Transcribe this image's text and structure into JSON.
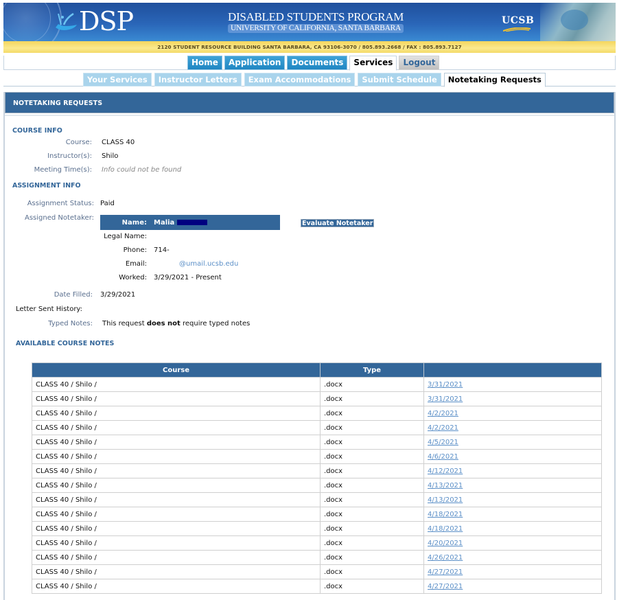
{
  "banner": {
    "logo_text": "DSP",
    "program_title": "DISABLED STUDENTS PROGRAM",
    "university": "UNIVERSITY OF CALIFORNIA, SANTA BARBARA",
    "ucsb_text": "UCSB",
    "address": "2120 STUDENT RESOURCE BUILDING SANTA BARBARA, CA 93106-3070 / 805.893.2668 / FAX : 805.893.7127"
  },
  "main_nav": {
    "tabs": [
      {
        "label": "Home",
        "active": false
      },
      {
        "label": "Application",
        "active": false
      },
      {
        "label": "Documents",
        "active": false
      },
      {
        "label": "Services",
        "active": true
      },
      {
        "label": "Logout",
        "active": false
      }
    ]
  },
  "sub_nav": {
    "tabs": [
      {
        "label": "Your Services",
        "active": false
      },
      {
        "label": "Instructor Letters",
        "active": false
      },
      {
        "label": "Exam Accommodations",
        "active": false
      },
      {
        "label": "Submit Schedule",
        "active": false
      },
      {
        "label": "Notetaking Requests",
        "active": true
      }
    ]
  },
  "panel": {
    "header": "NOTETAKING REQUESTS",
    "course_info": {
      "title": "COURSE INFO",
      "course_label": "Course:",
      "course_value": "CLASS 40",
      "instructor_label": "Instructor(s):",
      "instructor_value": "Shilo",
      "meeting_label": "Meeting Time(s):",
      "meeting_value": "Info could not be found"
    },
    "assignment_info": {
      "title": "ASSIGNMENT INFO",
      "status_label": "Assignment Status:",
      "status_value": "Paid",
      "notetaker_label": "Assigned Notetaker:",
      "notetaker": {
        "name_label": "Name:",
        "name_value": "Malia",
        "legal_name_label": "Legal Name:",
        "legal_name_value": "",
        "phone_label": "Phone:",
        "phone_value": "714-",
        "email_label": "Email:",
        "email_value": "@umail.ucsb.edu",
        "worked_label": "Worked:",
        "worked_value": "3/29/2021 - Present"
      },
      "evaluate_button": "Evaluate Notetaker",
      "date_filled_label": "Date Filled:",
      "date_filled_value": "3/29/2021",
      "letter_history_label": "Letter Sent History:",
      "typed_notes_label": "Typed Notes:",
      "typed_notes_prefix": "This request ",
      "typed_notes_bold": "does not",
      "typed_notes_suffix": " require typed notes"
    },
    "available_notes": {
      "title": "AVAILABLE COURSE NOTES",
      "columns": [
        "Course",
        "Type",
        ""
      ],
      "rows": [
        {
          "course": "CLASS 40 / Shilo /",
          "type": ".docx",
          "date": "3/31/2021"
        },
        {
          "course": "CLASS 40 / Shilo /",
          "type": ".docx",
          "date": "3/31/2021"
        },
        {
          "course": "CLASS 40 / Shilo /",
          "type": ".docx",
          "date": "4/2/2021"
        },
        {
          "course": "CLASS 40 / Shilo /",
          "type": ".docx",
          "date": "4/2/2021"
        },
        {
          "course": "CLASS 40 / Shilo /",
          "type": ".docx",
          "date": "4/5/2021"
        },
        {
          "course": "CLASS 40 / Shilo /",
          "type": ".docx",
          "date": "4/6/2021"
        },
        {
          "course": "CLASS 40 / Shilo /",
          "type": ".docx",
          "date": "4/12/2021"
        },
        {
          "course": "CLASS 40 / Shilo /",
          "type": ".docx",
          "date": "4/13/2021"
        },
        {
          "course": "CLASS 40 / Shilo /",
          "type": ".docx",
          "date": "4/13/2021"
        },
        {
          "course": "CLASS 40 / Shilo /",
          "type": ".docx",
          "date": "4/18/2021"
        },
        {
          "course": "CLASS 40 / Shilo /",
          "type": ".docx",
          "date": "4/18/2021"
        },
        {
          "course": "CLASS 40 / Shilo /",
          "type": ".docx",
          "date": "4/20/2021"
        },
        {
          "course": "CLASS 40 / Shilo /",
          "type": ".docx",
          "date": "4/26/2021"
        },
        {
          "course": "CLASS 40 / Shilo /",
          "type": ".docx",
          "date": "4/27/2021"
        },
        {
          "course": "CLASS 40 / Shilo /",
          "type": ".docx",
          "date": "4/27/2021"
        }
      ]
    }
  },
  "colors": {
    "header_blue": "#336699",
    "label_gray_blue": "#5a6f8e",
    "link_blue": "#5b8fc7",
    "address_yellow": "#fbe98e",
    "nav_tab_blue": "#1f86c2",
    "sub_tab_light_blue": "#a9d4ec"
  }
}
